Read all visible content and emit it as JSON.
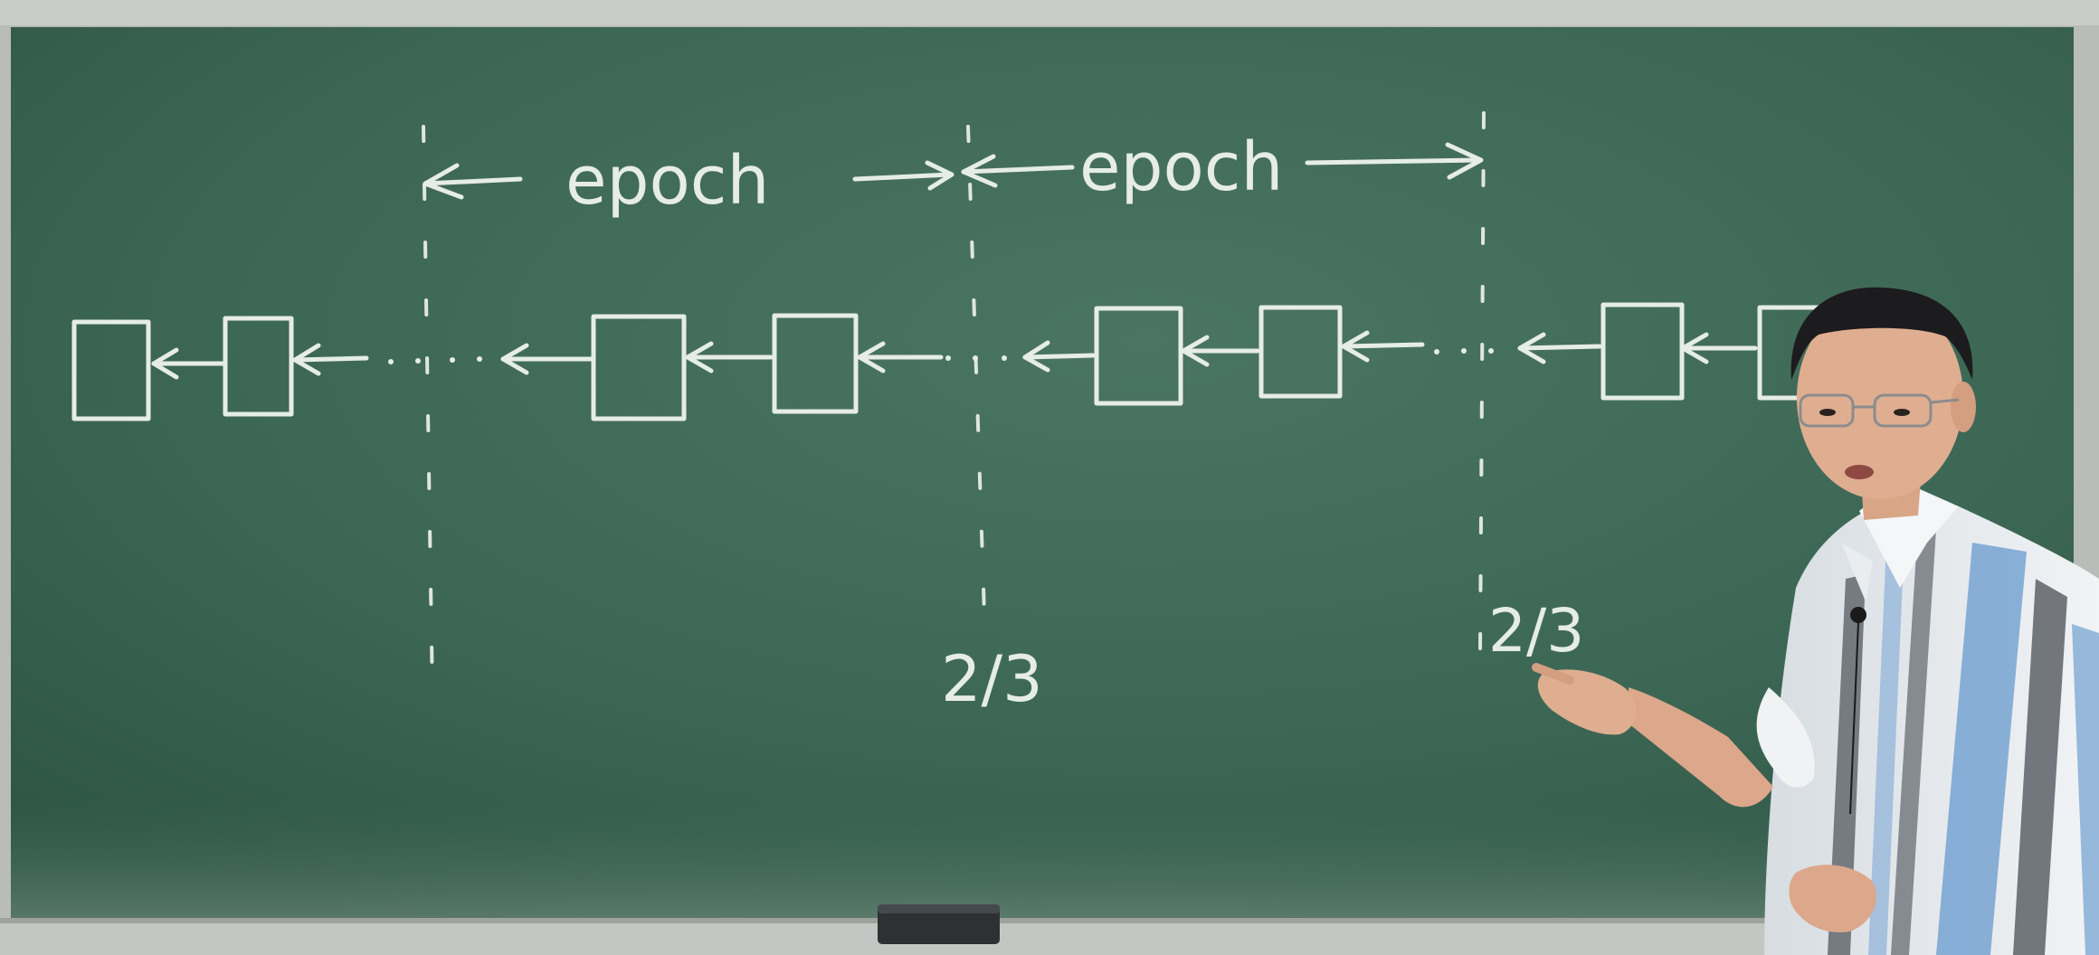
{
  "board": {
    "epoch_left": "epoch",
    "epoch_right": "epoch",
    "fraction_mid": "2/3",
    "fraction_right": "2/3"
  },
  "colors": {
    "board_green": "#3f6a58",
    "chalk": "#e6ece6",
    "frame": "#b9bcb8",
    "shirt_stripe_blue": "#6f9fd0",
    "shirt_stripe_dark": "#4a4e56"
  }
}
